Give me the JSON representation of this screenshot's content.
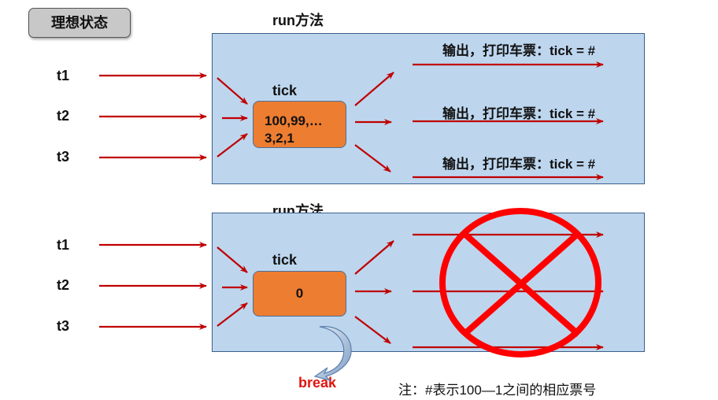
{
  "badge": "理想状态",
  "top": {
    "run_label": "run方法",
    "threads": [
      "t1",
      "t2",
      "t3"
    ],
    "tick_label": "tick",
    "tick_line1": "100,99,…",
    "tick_line2": "3,2,1",
    "outputs": [
      "输出，打印车票：tick = #",
      "输出，打印车票：tick = #",
      "输出，打印车票：tick = #"
    ]
  },
  "bottom": {
    "run_label": "run方法",
    "threads": [
      "t1",
      "t2",
      "t3"
    ],
    "tick_label": "tick",
    "tick_value": "0",
    "break_label": "break"
  },
  "note": "注：#表示100—1之间的相应票号",
  "colors": {
    "arrow": "#c00000",
    "panel": "#bdd6ee",
    "box": "#ed7d31",
    "cross": "#ff0000"
  }
}
